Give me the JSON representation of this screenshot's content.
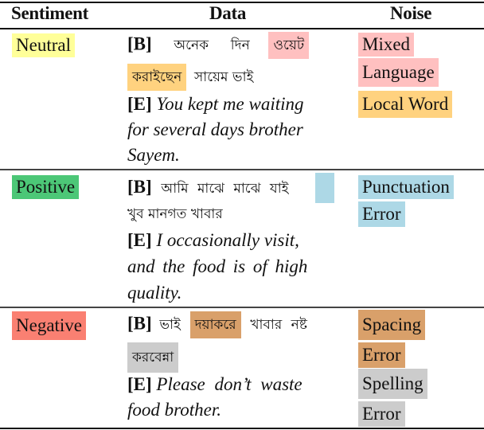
{
  "header": {
    "sentiment": "Sentiment",
    "data": "Data",
    "noise": "Noise"
  },
  "colors": {
    "neutral": "#ffff99",
    "positive": "#4cc777",
    "negative": "#fa8072",
    "mixed_language": "#ffc0c0",
    "local_word": "#ffd27f",
    "punctuation_error": "#add8e6",
    "spacing_error": "#d9a06a",
    "spelling_error": "#cccccc"
  },
  "rows": [
    {
      "sentiment": "Neutral",
      "bangla_tag": "[B]",
      "bangla_line1": [
        "অনেক",
        "দিন"
      ],
      "bangla_hl1": "ওয়েট",
      "bangla_hl2": "করাইছেন",
      "bangla_line2_rest": "সায়েম ভাই",
      "english_tag": "[E]",
      "english_lines": [
        "You kept me waiting",
        "for several days brother",
        "Sayem."
      ],
      "noise": [
        "Mixed",
        "Language",
        "Local Word"
      ]
    },
    {
      "sentiment": "Positive",
      "bangla_tag": "[B]",
      "bangla_line1": "আমি মাঝে মাঝে যাই",
      "bangla_line2": "খুব মানগত খাবার",
      "english_tag": "[E]",
      "english_lines": [
        "I occasionally visit,",
        "and the food is of high",
        "quality."
      ],
      "noise": [
        "Punctuation",
        "Error"
      ]
    },
    {
      "sentiment": "Negative",
      "bangla_tag": "[B]",
      "bangla_pre": "ভাই",
      "bangla_hl1": "দয়াকরে",
      "bangla_post": "খাবার নষ্ট",
      "bangla_hl2": "করবেন্না",
      "english_tag": "[E]",
      "english_lines": [
        "Please don’t waste",
        "food brother."
      ],
      "noise": [
        "Spacing",
        "Error",
        "Spelling",
        "Error"
      ]
    }
  ]
}
